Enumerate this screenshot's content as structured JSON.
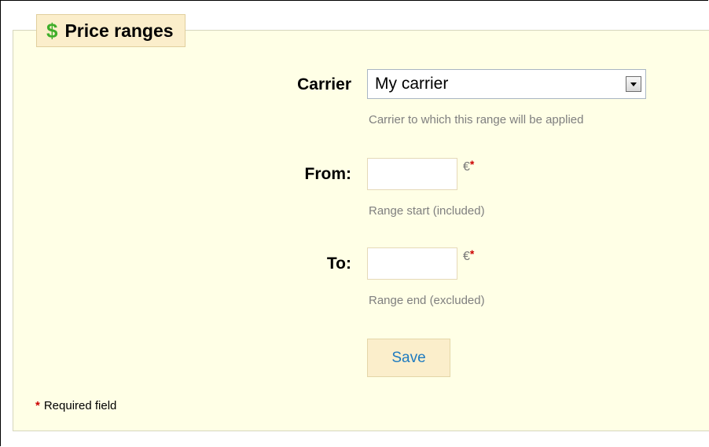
{
  "panel": {
    "title": "Price ranges",
    "icon": "dollar-icon",
    "accent_color": "#3fae2a"
  },
  "form": {
    "carrier": {
      "label": "Carrier",
      "selected": "My carrier",
      "hint": "Carrier to which this range will be applied"
    },
    "from": {
      "label": "From:",
      "value": "",
      "unit": "€",
      "required_mark": "*",
      "hint": "Range start (included)"
    },
    "to": {
      "label": "To:",
      "value": "",
      "unit": "€",
      "required_mark": "*",
      "hint": "Range end (excluded)"
    },
    "save_label": "Save"
  },
  "footer": {
    "required_mark": "*",
    "required_text": "Required field"
  }
}
